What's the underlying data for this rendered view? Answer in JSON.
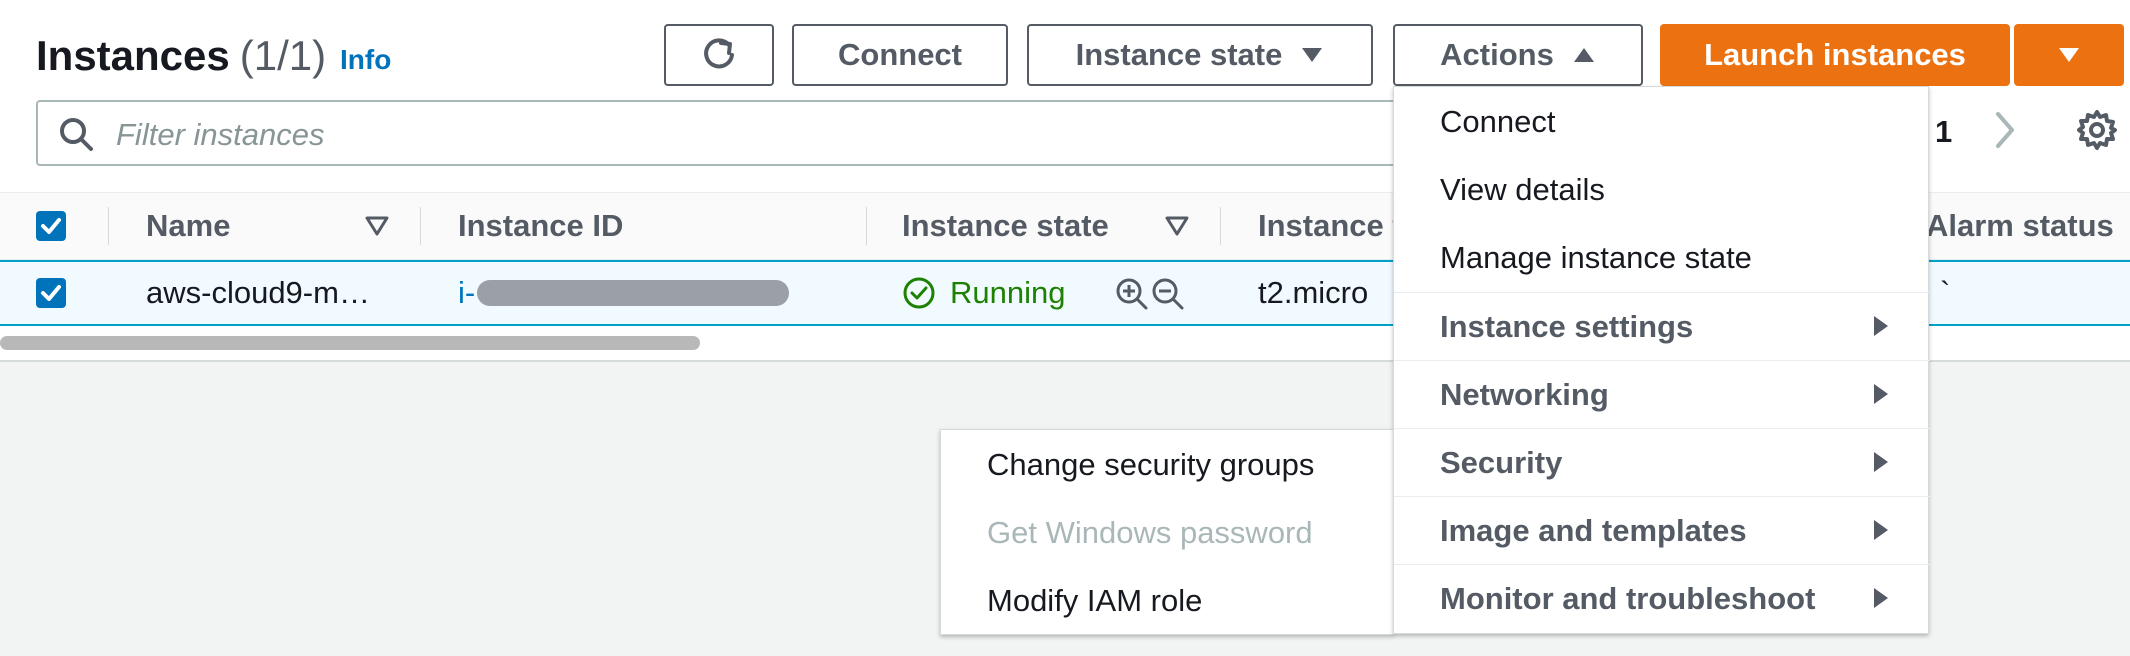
{
  "header": {
    "title": "Instances",
    "count": "(1/1)",
    "info_label": "Info"
  },
  "toolbar": {
    "refresh_icon": "refresh-icon",
    "connect_label": "Connect",
    "instance_state_label": "Instance state",
    "actions_label": "Actions",
    "launch_label": "Launch instances",
    "launch_color": "#ec7211"
  },
  "search": {
    "placeholder": "Filter instances",
    "value": ""
  },
  "pagination": {
    "current_page": "1"
  },
  "table": {
    "columns": [
      "Name",
      "Instance ID",
      "Instance state",
      "Instance t",
      "Alarm status"
    ],
    "rows": [
      {
        "name": "aws-cloud9-m…",
        "instance_id_prefix": "i-",
        "state": "Running",
        "type": "t2.micro",
        "alarm_status": "`"
      }
    ]
  },
  "actions_menu": {
    "items": [
      {
        "label": "Connect"
      },
      {
        "label": "View details"
      },
      {
        "label": "Manage instance state"
      },
      {
        "label": "Instance settings"
      },
      {
        "label": "Networking"
      },
      {
        "label": "Security"
      },
      {
        "label": "Image and templates"
      },
      {
        "label": "Monitor and troubleshoot"
      }
    ]
  },
  "security_submenu": {
    "items": [
      {
        "label": "Change security groups",
        "disabled": false
      },
      {
        "label": "Get Windows password",
        "disabled": true
      },
      {
        "label": "Modify IAM role",
        "disabled": false
      }
    ]
  },
  "colors": {
    "link": "#0073bb",
    "running": "#1d8102",
    "selected_row_border": "#00a1c9"
  }
}
